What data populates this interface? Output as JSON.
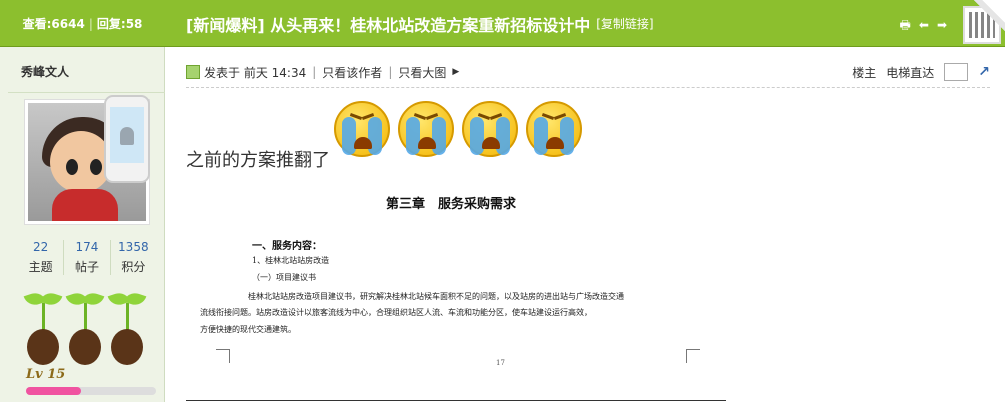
{
  "stats": {
    "views_label": "查看:",
    "views": "6644",
    "replies_label": "回复:",
    "replies": "58"
  },
  "thread": {
    "title": "[新闻爆料] 从头再来！桂林北站改造方案重新招标设计中",
    "copy_link": "[复制链接]"
  },
  "icons": {
    "print": "print-icon",
    "prev": "arrow-left-icon",
    "next": "arrow-right-icon",
    "qr": "qr-code-icon"
  },
  "profile": {
    "username": "秀峰文人",
    "stats": [
      {
        "value": "22",
        "label": "主题"
      },
      {
        "value": "174",
        "label": "帖子"
      },
      {
        "value": "1358",
        "label": "积分"
      }
    ],
    "level": "Lv 15",
    "level_progress": 0.42
  },
  "post": {
    "posted_prefix": "发表于",
    "posted_time": "前天 14:34",
    "author_only": "只看该作者",
    "big_image": "只看大图",
    "floor": "楼主",
    "jump_label": "电梯直达"
  },
  "content": {
    "text": "之前的方案推翻了",
    "emoji_count": 4
  },
  "document": {
    "heading": "第三章　服务采购需求",
    "section": "一、服务内容：",
    "lines": [
      "1、桂林北站站房改造",
      "（一）项目建议书",
      "桂林北站站房改造项目建议书，研究解决桂林北站候车面积不足的问题，以及站房的进出站与广场改造交通",
      "流线衔接问题。站房改造设计以旅客流线为中心，合理组织站区人流、车流和功能分区，使车站建设运行高效，",
      "方便快捷的现代交通建筑。"
    ],
    "page_number": "17"
  },
  "colors": {
    "topbar": "#8cbf2e",
    "profile_bg": "#eef3e6",
    "link": "#3366aa"
  }
}
